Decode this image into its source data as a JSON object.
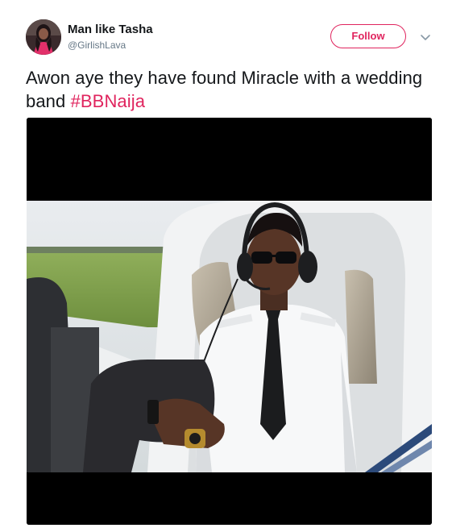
{
  "author": {
    "display_name": "Man like Tasha",
    "handle": "@GirlishLava",
    "avatar_icon": "user-avatar"
  },
  "actions": {
    "follow_label": "Follow",
    "more_icon": "chevron-down-icon"
  },
  "tweet": {
    "text_before": "Awon aye they have found Miracle with a wedding band ",
    "hashtag": "#BBNaija"
  },
  "media": {
    "type": "photo"
  },
  "colors": {
    "accent": "#e0245e",
    "text": "#14171a",
    "secondary_text": "#657786"
  }
}
